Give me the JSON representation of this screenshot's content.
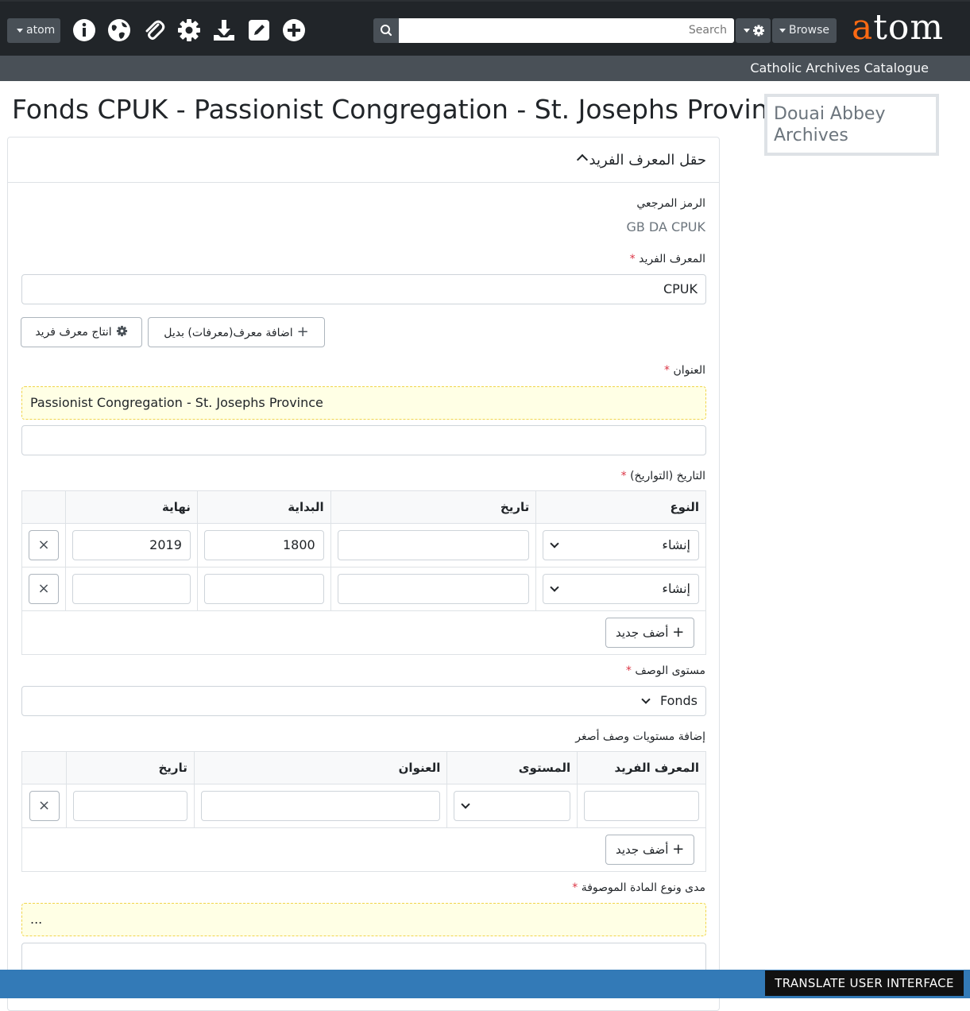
{
  "navbar": {
    "atom_menu_label": "atom",
    "search_placeholder": "Search",
    "browse_label": "Browse",
    "logo_accent": "a",
    "logo_rest": "tom",
    "site_name": "Catholic Archives Catalogue",
    "icons": [
      "info-icon",
      "globe-icon",
      "clipboard-icon",
      "gear-icon",
      "download-icon",
      "edit-icon",
      "plus-circle-icon"
    ]
  },
  "page": {
    "title": "Fonds CPUK - Passionist Congregation - St. Josephs Province",
    "repository": "Douai Abbey Archives"
  },
  "section": {
    "header": "حقل المعرف الفريد"
  },
  "reference_code": {
    "label": "الرمز المرجعي",
    "value": "GB DA CPUK"
  },
  "identifier": {
    "label": "المعرف الفريد",
    "required_mark": "*",
    "value": "CPUK",
    "add_alt_label": "اضافة معرف(معرفات) بديل",
    "generate_label": "انتاج معرف فريد"
  },
  "title_field": {
    "label": "العنوان",
    "required_mark": "*",
    "source_value": "Passionist Congregation - St. Josephs Province",
    "value": ""
  },
  "dates": {
    "label": "التاريخ (التواريخ)",
    "required_mark": "*",
    "headers": [
      "النوع",
      "تاريخ",
      "البداية",
      "نهاية"
    ],
    "rows": [
      {
        "type": "إنشاء",
        "date": "",
        "start": "1800",
        "end": "2019"
      },
      {
        "type": "إنشاء",
        "date": "",
        "start": "",
        "end": ""
      }
    ],
    "add_new_label": "أضف جديد",
    "remove_glyph": "×"
  },
  "level": {
    "label": "مستوى الوصف",
    "required_mark": "*",
    "value": "Fonds"
  },
  "child_levels": {
    "label": "إضافة مستويات وصف أصغر",
    "headers": [
      "المعرف الفريد",
      "المستوى",
      "العنوان",
      "تاريخ"
    ],
    "add_new_label": "أضف جديد",
    "remove_glyph": "×"
  },
  "extent": {
    "label": "مدى ونوع المادة الموصوفة",
    "required_mark": "*",
    "source_value": "..."
  },
  "translate": {
    "label": "TRANSLATE USER INTERFACE"
  },
  "colors": {
    "navbar": "#212529",
    "subbar": "#495057",
    "logo_accent": "#ff6a13",
    "required": "#dc3545",
    "translate_bar": "#337ab7"
  }
}
